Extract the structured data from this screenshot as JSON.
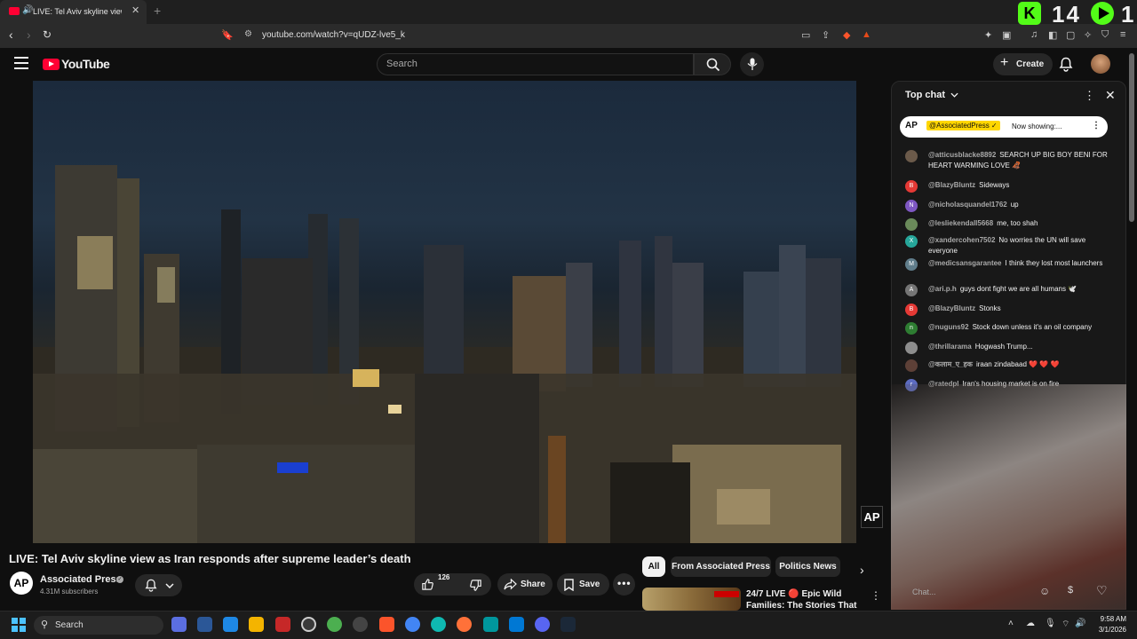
{
  "browser": {
    "tab_title": "LIVE: Tel Aviv skyline view as I",
    "address": "youtube.com/watch?v=qUDZ-lve5_k"
  },
  "overlay": {
    "count_a": "14",
    "count_b": "1"
  },
  "header": {
    "logo_text": "YouTube",
    "search_placeholder": "Search",
    "create_label": "Create"
  },
  "video": {
    "title": "LIVE: Tel Aviv skyline view as Iran responds after supreme leader’s death",
    "watermark": "AP"
  },
  "channel": {
    "avatar_text": "AP",
    "name": "Associated Press",
    "subscribers": "4.31M subscribers"
  },
  "actions": {
    "like_count": "126",
    "share_label": "Share",
    "save_label": "Save"
  },
  "chips": [
    "All",
    "From Associated Press",
    "Politics News"
  ],
  "recommended": {
    "title": "24/7 LIVE 🔴 Epic Wild Families: The Stories That ..."
  },
  "chat": {
    "header": "Top chat",
    "pinned_avatar": "AP",
    "pinned_author": "@AssociatedPress ✓",
    "pinned_text": "Now showing:...",
    "messages": [
      {
        "user": "@atticusblacke8892",
        "text": "SEARCH UP BIG BOY BENI FOR HEART WARMING LOVE 🦧",
        "initial": "",
        "color": "#6b5a4a"
      },
      {
        "user": "@BlazyBluntz",
        "text": "Sideways",
        "initial": "B",
        "color": "#e53935"
      },
      {
        "user": "@nicholasquandel1762",
        "text": "up",
        "initial": "N",
        "color": "#7e57c2"
      },
      {
        "user": "@lesliekendall5668",
        "text": "me, too shah",
        "initial": "",
        "color": "#6a8a5a"
      },
      {
        "user": "@xandercohen7502",
        "text": "No worries the UN will save everyone",
        "initial": "X",
        "color": "#26a69a"
      },
      {
        "user": "@medicsansgarantee",
        "text": "I think they lost most launchers",
        "initial": "M",
        "color": "#607d8b"
      },
      {
        "user": "@ari.p.h",
        "text": "guys dont fight we are all humans 🕊️",
        "initial": "A",
        "color": "#757575"
      },
      {
        "user": "@BlazyBluntz",
        "text": "Stonks",
        "initial": "B",
        "color": "#e53935"
      },
      {
        "user": "@nuguns92",
        "text": "Stock down unless it's an oil company",
        "initial": "n",
        "color": "#2e7d32"
      },
      {
        "user": "@thrillarama",
        "text": "Hogwash Trump...",
        "initial": "",
        "color": "#8d8d8d"
      },
      {
        "user": "@कलाम_ए_हक",
        "text": "iraan zindabaad ❤️ ❤️ ❤️",
        "initial": "",
        "color": "#5d4037"
      },
      {
        "user": "@ratedpl",
        "text": "Iran's housing market is on fire",
        "initial": "r",
        "color": "#5c6bc0"
      }
    ],
    "input_placeholder": "Chat..."
  },
  "taskbar": {
    "search_label": "Search",
    "time": "9:58 AM",
    "date": "3/1/2026"
  }
}
